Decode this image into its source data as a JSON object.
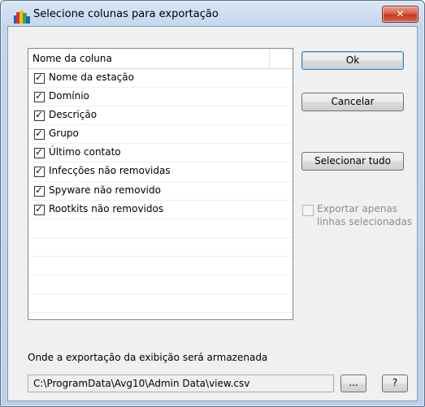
{
  "window": {
    "title": "Selecione colunas para exportação",
    "close_label": "✕"
  },
  "list": {
    "header": "Nome da coluna",
    "items": [
      {
        "label": "Nome da estação",
        "checked": true
      },
      {
        "label": "Domínio",
        "checked": true
      },
      {
        "label": "Descrição",
        "checked": true
      },
      {
        "label": "Grupo",
        "checked": true
      },
      {
        "label": "Último contato",
        "checked": true
      },
      {
        "label": "Infecções não removidas",
        "checked": true
      },
      {
        "label": "Spyware não removido",
        "checked": true
      },
      {
        "label": "Rootkits não removidos",
        "checked": true
      }
    ]
  },
  "buttons": {
    "ok": "Ok",
    "cancel": "Cancelar",
    "select_all": "Selecionar tudo",
    "browse": "...",
    "help": "?"
  },
  "export_selected": {
    "label": "Exportar apenas linhas selecionadas",
    "checked": false,
    "enabled": false
  },
  "path": {
    "label": "Onde a exportação da exibição será armazenada",
    "value": "C:\\ProgramData\\Avg10\\Admin Data\\view.csv"
  }
}
